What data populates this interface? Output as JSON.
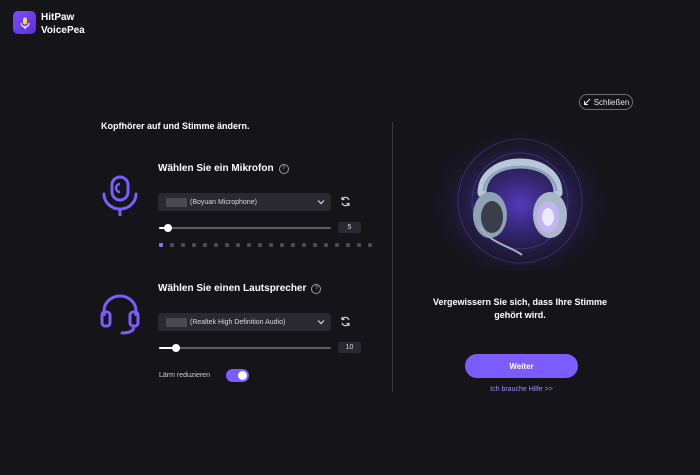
{
  "app": {
    "name_line1": "HitPaw",
    "name_line2": "VoicePea"
  },
  "close": {
    "label": "Schließen"
  },
  "heading": "Kopfhörer auf und Stimme ändern.",
  "microphone": {
    "title": "Wählen Sie ein Mikrofon",
    "selected": "(Boyuan Microphone)",
    "volume_value": "5",
    "volume_fraction": 0.05,
    "level_active_count": 1,
    "level_total": 20
  },
  "speaker": {
    "title": "Wählen Sie einen Lautsprecher",
    "selected": "(Realtek High Definition Audio)",
    "volume_value": "10",
    "volume_fraction": 0.1
  },
  "noise": {
    "label": "Lärm reduzieren",
    "enabled": true
  },
  "hero": {
    "text_line1": "Vergewissern Sie sich, dass Ihre Stimme",
    "text_line2": "gehört wird."
  },
  "primary_button": {
    "label": "Weiter"
  },
  "help_link": {
    "label": "Ich brauche Hilfe >>"
  },
  "colors": {
    "accent": "#7b5cff",
    "background": "#151419",
    "link": "#9d8cff"
  }
}
